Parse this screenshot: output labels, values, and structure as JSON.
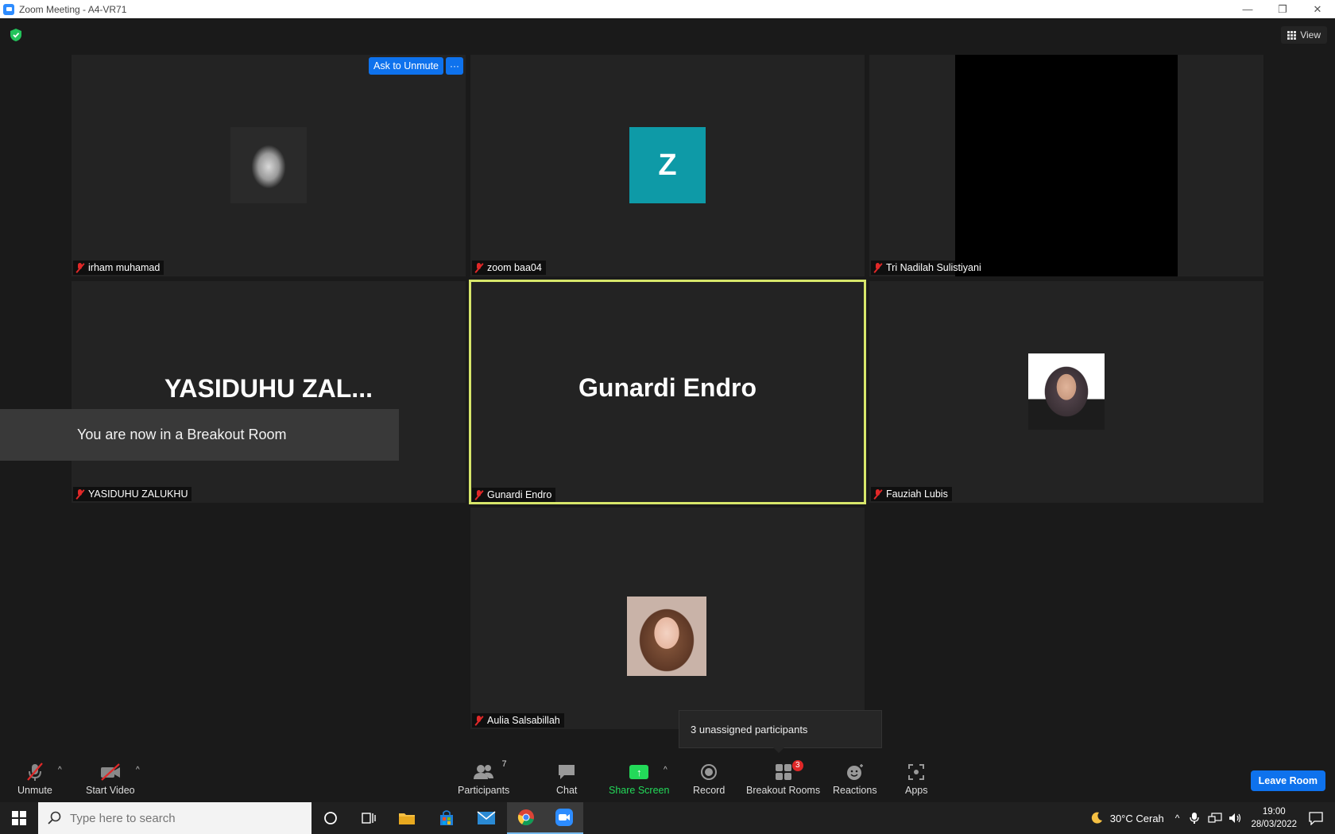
{
  "window": {
    "title": "Zoom Meeting - A4-VR71",
    "controls": [
      "—",
      "❐",
      "✕"
    ]
  },
  "top": {
    "view_label": "View"
  },
  "tiles": [
    {
      "name": "irham muhamad",
      "ask_unmute": "Ask to Unmute",
      "more": "···"
    },
    {
      "name": "zoom baa04",
      "initial": "Z"
    },
    {
      "name": "Tri Nadilah Sulistiyani"
    },
    {
      "name": "YASIDUHU ZALUKHU",
      "display": "YASIDUHU  ZAL..."
    },
    {
      "name": "Gunardi Endro",
      "display": "Gunardi Endro"
    },
    {
      "name": "Fauziah Lubis"
    },
    {
      "name": "Aulia Salsabillah"
    }
  ],
  "notification": {
    "text": "You are now in a Breakout Room"
  },
  "tooltip": {
    "text": "3 unassigned participants"
  },
  "toolbar": {
    "unmute": "Unmute",
    "start_video": "Start Video",
    "participants": "Participants",
    "participants_count": "7",
    "chat": "Chat",
    "share_screen": "Share Screen",
    "record": "Record",
    "breakout_rooms": "Breakout Rooms",
    "breakout_badge": "3",
    "reactions": "Reactions",
    "apps": "Apps",
    "leave": "Leave Room"
  },
  "taskbar": {
    "search_placeholder": "Type here to search",
    "weather": "30°C  Cerah",
    "time": "19:00",
    "date": "28/03/2022"
  },
  "colors": {
    "accent": "#0e72ed",
    "active_speaker": "#d7e66a",
    "share": "#23d959",
    "muted": "#e02828",
    "avatar_z": "#0e9aa7"
  }
}
